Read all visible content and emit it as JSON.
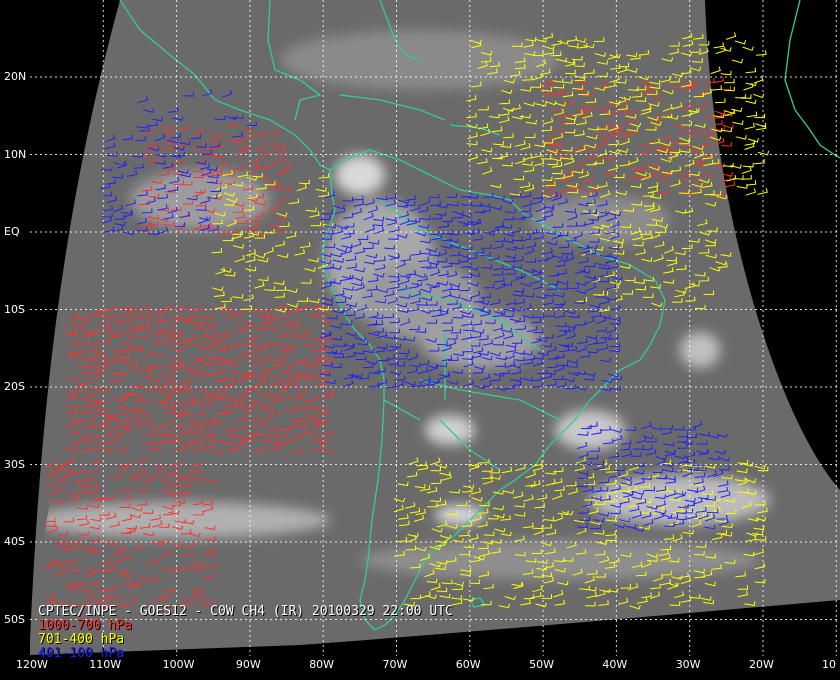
{
  "title": "CPTEC/INPE - GOES12 - C0W CH4 (IR) 20100329 22:00 UTC",
  "legend": [
    {
      "label": "1000-700 hPa",
      "color": "#ff3030"
    },
    {
      "label": "701-400 hPa",
      "color": "#ffff00"
    },
    {
      "label": "401-100 hPa",
      "color": "#2020ff"
    }
  ],
  "colors": {
    "background": "#000000",
    "coastline": "#33cc99",
    "grid": "#ffffff",
    "satellite_gray": "#6e6e6e"
  },
  "lat_labels": [
    "20N",
    "10N",
    "EQ",
    "10S",
    "20S",
    "30S",
    "40S",
    "50S"
  ],
  "lon_labels": [
    "120W",
    "110W",
    "100W",
    "90W",
    "80W",
    "70W",
    "60W",
    "50W",
    "40W",
    "30W",
    "20W",
    "10"
  ],
  "wind_regions": [
    {
      "level": "1000-700 hPa",
      "color": "#ff3030",
      "lon": [
        -115,
        -80
      ],
      "lat": [
        -28,
        -10
      ],
      "density": 0.8
    },
    {
      "level": "1000-700 hPa",
      "color": "#ff3030",
      "lon": [
        -118,
        -95
      ],
      "lat": [
        -48,
        -30
      ],
      "density": 0.6
    },
    {
      "level": "1000-700 hPa",
      "color": "#ff3030",
      "lon": [
        -105,
        -85
      ],
      "lat": [
        0,
        14
      ],
      "density": 0.4
    },
    {
      "level": "1000-700 hPa",
      "color": "#ff3030",
      "lon": [
        -50,
        -25
      ],
      "lat": [
        5,
        20
      ],
      "density": 0.4
    },
    {
      "level": "701-400 hPa",
      "color": "#ffff00",
      "lon": [
        -60,
        -20
      ],
      "lat": [
        5,
        25
      ],
      "density": 0.45
    },
    {
      "level": "701-400 hPa",
      "color": "#ffff00",
      "lon": [
        -95,
        -80
      ],
      "lat": [
        -10,
        8
      ],
      "density": 0.35
    },
    {
      "level": "701-400 hPa",
      "color": "#ffff00",
      "lon": [
        -70,
        -20
      ],
      "lat": [
        -48,
        -30
      ],
      "density": 0.4
    },
    {
      "level": "701-400 hPa",
      "color": "#ffff00",
      "lon": [
        -45,
        -25
      ],
      "lat": [
        -10,
        5
      ],
      "density": 0.35
    },
    {
      "level": "401-100 hPa",
      "color": "#2020ff",
      "lon": [
        -80,
        -40
      ],
      "lat": [
        -20,
        5
      ],
      "density": 0.75
    },
    {
      "level": "401-100 hPa",
      "color": "#2020ff",
      "lon": [
        -45,
        -25
      ],
      "lat": [
        -38,
        -25
      ],
      "density": 0.7
    },
    {
      "level": "401-100 hPa",
      "color": "#2020ff",
      "lon": [
        -110,
        -95
      ],
      "lat": [
        0,
        12
      ],
      "density": 0.45
    },
    {
      "level": "401-100 hPa",
      "color": "#2020ff",
      "lon": [
        -105,
        -90
      ],
      "lat": [
        12,
        18
      ],
      "density": 0.3
    }
  ]
}
